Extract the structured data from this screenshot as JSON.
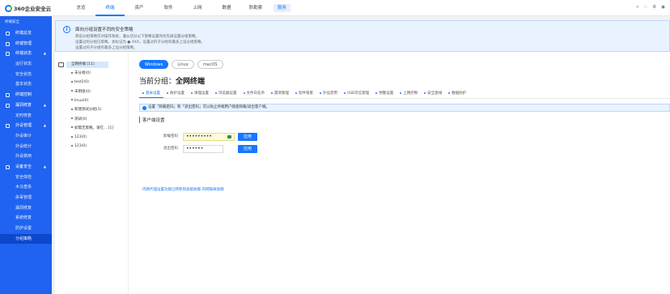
{
  "app": {
    "logo_text": "360企业安全云"
  },
  "topnav": {
    "items": [
      "总览",
      "终端",
      "资产",
      "软件",
      "上网",
      "数据",
      "防勒索"
    ],
    "active_index": 1,
    "service_label": "服务",
    "right_icons": [
      "search-icon",
      "bell-icon",
      "settings-icon",
      "user-icon"
    ]
  },
  "sidebar": {
    "header": "终端安全",
    "items": [
      {
        "label": "终端总览",
        "icon": "dashboard-icon",
        "sub": false
      },
      {
        "label": "终端管理",
        "icon": "terminal-icon",
        "sub": false
      },
      {
        "label": "终端状态",
        "icon": "status-icon",
        "sub": false,
        "expanded": true
      },
      {
        "label": "运行状态",
        "sub": true
      },
      {
        "label": "安全状态",
        "sub": true
      },
      {
        "label": "基本状态",
        "sub": true
      },
      {
        "label": "终端控制",
        "icon": "control-icon",
        "sub": false
      },
      {
        "label": "漏洞修复",
        "icon": "patch-icon",
        "sub": false,
        "expanded": true
      },
      {
        "label": "定时修复",
        "sub": true
      },
      {
        "label": "外设管理",
        "icon": "device-icon",
        "sub": false,
        "expanded": true
      },
      {
        "label": "外设审计",
        "sub": true
      },
      {
        "label": "外设统计",
        "sub": true
      },
      {
        "label": "外设禁用",
        "sub": true
      },
      {
        "label": "设备安全",
        "icon": "shield-icon",
        "sub": false,
        "expanded": true
      },
      {
        "label": "安全体检",
        "sub": true
      },
      {
        "label": "木马查杀",
        "sub": true
      },
      {
        "label": "杀毒管理",
        "sub": true
      },
      {
        "label": "漏洞修复",
        "sub": true
      },
      {
        "label": "系统修复",
        "sub": true
      },
      {
        "label": "防护设置",
        "sub": true
      },
      {
        "label": "分组策略",
        "sub": true,
        "active": true
      }
    ]
  },
  "banner": {
    "title": "面向分组设置不同的安全策略",
    "lines": [
      "目前分组策略仅对操作系统，遵从切分以下策略设置的优先级设置分组策略。",
      "设置过的分组已策略，会标记为 ● XXX，设置过的子分组有最多上设分组策略。",
      "设置过的子分组有最多上设分组策略。"
    ]
  },
  "tree": {
    "root": "全网终端 [11]",
    "nodes": [
      "未分组(0)",
      "test2(0)",
      "未明组(0)",
      "linux(0)",
      "新建测试分组(1)",
      "测试(0)",
      "如需无策略。请在... [1]",
      "123(0)",
      "123(0)"
    ]
  },
  "panel": {
    "os_tabs": [
      "Windows",
      "Linux",
      "macOS"
    ],
    "active_os": 0,
    "group_title_prefix": "当前分组：",
    "group_title_name": "全网终端",
    "sub_tabs": [
      "基本设置",
      "防护设置",
      "清理设置",
      "浏览器设置",
      "文件白名单",
      "漏洞管理",
      "软件管家",
      "外设禁用",
      "USB可信管理",
      "预警设置",
      "上网控制",
      "安全基线",
      "数据防护"
    ],
    "active_sub_tab": 0,
    "notice": "设置「卸载密码」和「退出密码」可以防止终端用户随意卸载/退出客户端。",
    "section_title": "客户端设置",
    "uninstall_label": "卸载密码",
    "uninstall_value": "•••••••••",
    "exit_label": "退出密码",
    "exit_value": "••••••",
    "apply_label": "应用",
    "link_text": "内网代理设置功能已转移到高级防御-内网隔离防御"
  }
}
